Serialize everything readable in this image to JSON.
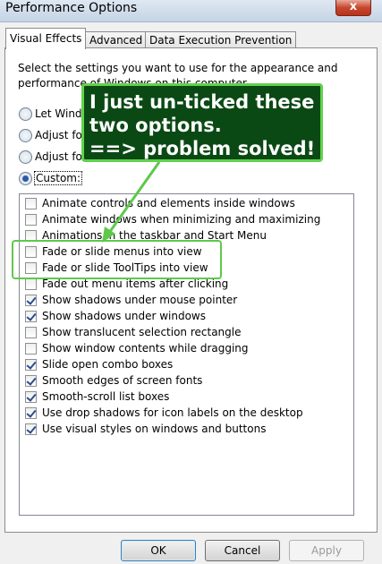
{
  "window": {
    "title": "Performance Options",
    "close_glyph": "x"
  },
  "tabs": [
    {
      "label": "Visual Effects",
      "active": true
    },
    {
      "label": "Advanced",
      "active": false
    },
    {
      "label": "Data Execution Prevention",
      "active": false
    }
  ],
  "description": "Select the settings you want to use for the appearance and performance of Windows on this computer.",
  "radios": [
    {
      "label": "Let Windo",
      "selected": false
    },
    {
      "label": "Adjust fo",
      "selected": false
    },
    {
      "label": "Adjust fo",
      "selected": false
    },
    {
      "label": "Custom:",
      "selected": true
    }
  ],
  "options": [
    {
      "label": "Animate controls and elements inside windows",
      "checked": false
    },
    {
      "label": "Animate windows when minimizing and maximizing",
      "checked": false
    },
    {
      "label": "Animations in the taskbar and Start Menu",
      "checked": false
    },
    {
      "label": "Fade or slide menus into view",
      "checked": false
    },
    {
      "label": "Fade or slide ToolTips into view",
      "checked": false
    },
    {
      "label": "Fade out menu items after clicking",
      "checked": false
    },
    {
      "label": "Show shadows under mouse pointer",
      "checked": true
    },
    {
      "label": "Show shadows under windows",
      "checked": true
    },
    {
      "label": "Show translucent selection rectangle",
      "checked": false
    },
    {
      "label": "Show window contents while dragging",
      "checked": false
    },
    {
      "label": "Slide open combo boxes",
      "checked": true
    },
    {
      "label": "Smooth edges of screen fonts",
      "checked": true
    },
    {
      "label": "Smooth-scroll list boxes",
      "checked": true
    },
    {
      "label": "Use drop shadows for icon labels on the desktop",
      "checked": true
    },
    {
      "label": "Use visual styles on windows and buttons",
      "checked": true
    }
  ],
  "annotation": {
    "text": "I just un-ticked these\ntwo options.\n==> problem solved!",
    "color_fill": "#0b4914",
    "color_border": "#61d24d"
  },
  "buttons": {
    "ok": "OK",
    "cancel": "Cancel",
    "apply": "Apply"
  },
  "colors": {
    "accent": "#2d5aa8",
    "close": "#c7472e"
  }
}
